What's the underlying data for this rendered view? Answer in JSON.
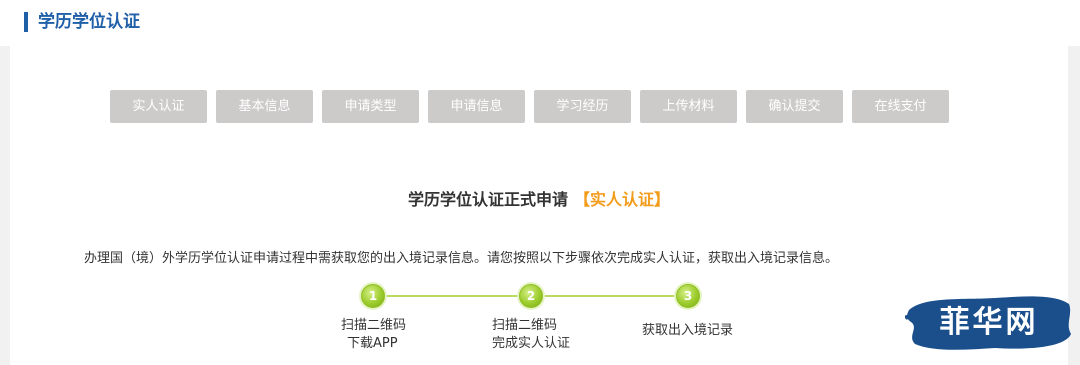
{
  "section": {
    "title": "学历学位认证"
  },
  "tabs": [
    {
      "label": "实人认证"
    },
    {
      "label": "基本信息"
    },
    {
      "label": "申请类型"
    },
    {
      "label": "申请信息"
    },
    {
      "label": "学习经历"
    },
    {
      "label": "上传材料"
    },
    {
      "label": "确认提交"
    },
    {
      "label": "在线支付"
    }
  ],
  "main": {
    "title": "学历学位认证正式申请",
    "highlight": "【实人认证】",
    "instruction": "办理国（境）外学历学位认证申请过程中需获取您的出入境记录信息。请您按照以下步骤依次完成实人认证，获取出入境记录信息。"
  },
  "steps": [
    {
      "number": "1",
      "line1": "扫描二维码",
      "line2": "下载APP"
    },
    {
      "number": "2",
      "line1": "扫描二维码",
      "line2": "完成实人认证"
    },
    {
      "number": "3",
      "line1": "获取出入境记录",
      "line2": ""
    }
  ],
  "watermark": {
    "text": "菲华网"
  },
  "colors": {
    "accent": "#1f5fa8",
    "highlight": "#f39c1c",
    "tab_bg": "#cdcaca",
    "step_green": "#9ccc2c"
  }
}
